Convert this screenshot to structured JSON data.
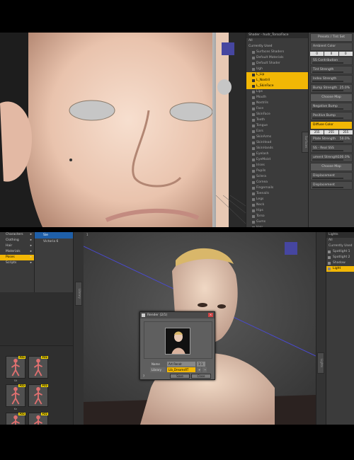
{
  "shader_panel": {
    "title": "Shader - hudr_Torso/Face",
    "tabs": [
      "All",
      "Currently Used"
    ],
    "tree": [
      "Surfaces Shaders",
      "Default Materials",
      "Default Shader",
      "Ugh",
      "L_Lip",
      "L_Nostril",
      "L_SkinFace",
      "Lips",
      "Mouth",
      "Nostrils",
      "Face",
      "SkinFace",
      "Teeth",
      "Tongue",
      "Ears",
      "SkinArms",
      "SkinHead",
      "SkinHands",
      "Eyelash",
      "EyeMoist",
      "Irises",
      "Pupils",
      "Sclera",
      "Cornea",
      "Fingernails",
      "Toenails",
      "Legs",
      "Neck",
      "Hips",
      "Torso",
      "Gums",
      "Hair",
      "Lashes",
      "Scalp"
    ],
    "selected": [
      "L_Lip",
      "L_Nostril",
      "L_SkinFace"
    ],
    "side_tab": "Surfaces"
  },
  "surface_panel": {
    "presets_label": "Presets / Tint Set",
    "ambient_label": "Ambient Color",
    "ambient_rgb": [
      "0",
      "0",
      "0"
    ],
    "props": [
      {
        "label": "SS Contribution",
        "value": ""
      },
      {
        "label": "Tint Strength",
        "value": ""
      },
      {
        "label": "Index Strength",
        "value": ""
      },
      {
        "label": "Bump Strength",
        "value": "25.0%"
      },
      {
        "label": "Choose Map",
        "value": "",
        "button": true
      },
      {
        "label": "Negative Bump",
        "value": ""
      },
      {
        "label": "Positive Bump",
        "value": ""
      }
    ],
    "diffuse_label": "Diffuse Color",
    "diffuse_rgb": [
      "255",
      "255",
      "255"
    ],
    "props2": [
      {
        "label": "Plate Strength",
        "value": "50.0%"
      },
      {
        "label": "SS - Real SSS",
        "value": ""
      },
      {
        "label": "ument Strength",
        "value": "100.0%"
      },
      {
        "label": "Choose Map",
        "value": "",
        "button": true
      },
      {
        "label": "Displacement",
        "value": ""
      },
      {
        "label": "Displacement",
        "value": ""
      }
    ]
  },
  "library": {
    "categories": [
      "Characters",
      "Clothing",
      "Hair",
      "Materials",
      "Poses",
      "Scripts"
    ],
    "selected_category": "Poses",
    "items": [
      "Sie",
      "Victoria 6"
    ],
    "selected_item": "Sie",
    "thumb_badge": "PZ2",
    "thumbs": [
      "Sit",
      "",
      "Kn",
      "",
      "St",
      ""
    ],
    "side_tab": "Library"
  },
  "viewport": {
    "badge_top": "1",
    "camera_label": "Main Camera"
  },
  "lights_panel": {
    "title": "Lights",
    "tabs": [
      "All",
      "Currently Used"
    ],
    "rows": [
      "Spotlight 1",
      "Spotlight 2",
      "Shadow",
      "Light"
    ],
    "selected": "Light",
    "side_tab": "Lights"
  },
  "render_dialog": {
    "title": "Render (2/1)",
    "name_label": "Name",
    "name_value": "Art Rendr",
    "size_value": "1:1",
    "dropdown_left": "Library",
    "dropdown_main": "Lib_DreamsRT",
    "save_label": "Save",
    "close_label": "Close"
  },
  "colors": {
    "accent": "#f2b705",
    "selection_blue": "#1f5fa8",
    "panel": "#3b3b3b"
  }
}
